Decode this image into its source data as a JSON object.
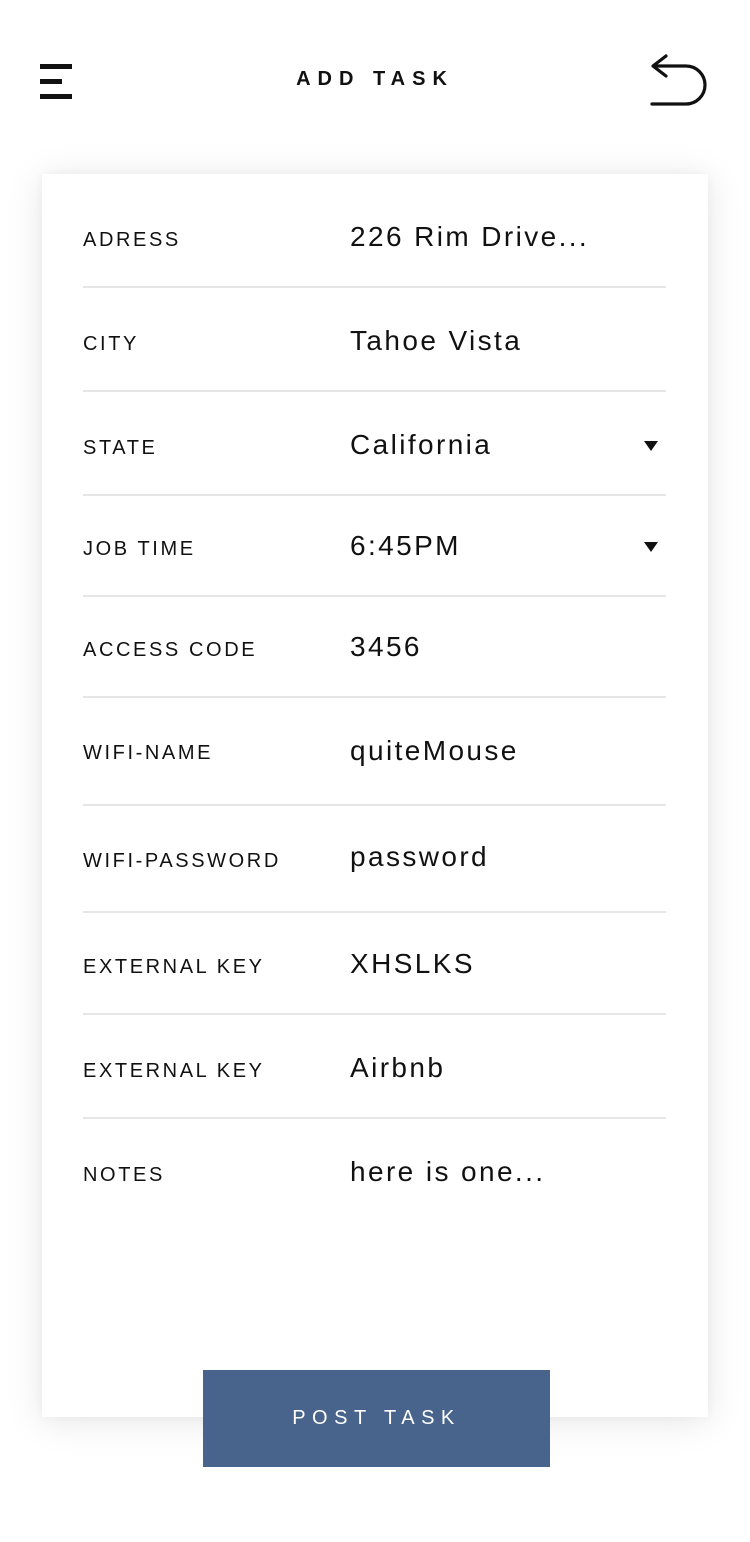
{
  "header": {
    "title": "ADD TASK",
    "menu_icon": "hamburger-menu-icon",
    "back_icon": "undo-arrow-icon"
  },
  "form": {
    "rows": [
      {
        "label": "ADRESS",
        "value": "226 Rim Drive..."
      },
      {
        "label": "CITY",
        "value": "Tahoe Vista"
      },
      {
        "label": "STATE",
        "value": "California",
        "dropdown": true
      },
      {
        "label": "JOB TIME",
        "value": "6:45PM",
        "dropdown": true
      },
      {
        "label": "ACCESS CODE",
        "value": "3456"
      },
      {
        "label": "WIFI-NAME",
        "value": "quiteMouse"
      },
      {
        "label": "WIFI-PASSWORD",
        "value": "password"
      },
      {
        "label": "EXTERNAL KEY",
        "value": "XHSLKS"
      },
      {
        "label": "EXTERNAL KEY",
        "value": "Airbnb"
      },
      {
        "label": "NOTES",
        "value": "here is one..."
      }
    ],
    "dropdown_icon": "caret-down-icon"
  },
  "actions": {
    "post_label": "POST TASK"
  },
  "colors": {
    "accent": "#48648d",
    "divider": "#e6e6e6",
    "text": "#111111",
    "background": "#ffffff"
  }
}
